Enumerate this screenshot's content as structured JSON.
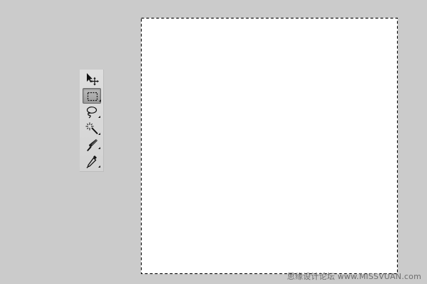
{
  "tools": [
    {
      "name": "move-tool",
      "icon": "move-icon",
      "active": false,
      "has_submenu": false
    },
    {
      "name": "rectangular-marquee-tool",
      "icon": "rect-marquee-icon",
      "active": true,
      "has_submenu": true
    },
    {
      "name": "lasso-tool",
      "icon": "lasso-icon",
      "active": false,
      "has_submenu": true
    },
    {
      "name": "magic-wand-tool",
      "icon": "magic-wand-icon",
      "active": false,
      "has_submenu": true
    },
    {
      "name": "crop-tool",
      "icon": "crop-icon",
      "active": false,
      "has_submenu": true
    },
    {
      "name": "eyedropper-tool",
      "icon": "eyedropper-icon",
      "active": false,
      "has_submenu": true
    }
  ],
  "canvas": {
    "fill": "#ffffff",
    "selection": "all"
  },
  "colors": {
    "workspace": "#cbcbcb",
    "toolbar": "#d8d8d8",
    "active_tool": "#a8a8a8"
  },
  "watermark": {
    "text": "思缘设计论坛 www.MISSVUAN.com"
  }
}
